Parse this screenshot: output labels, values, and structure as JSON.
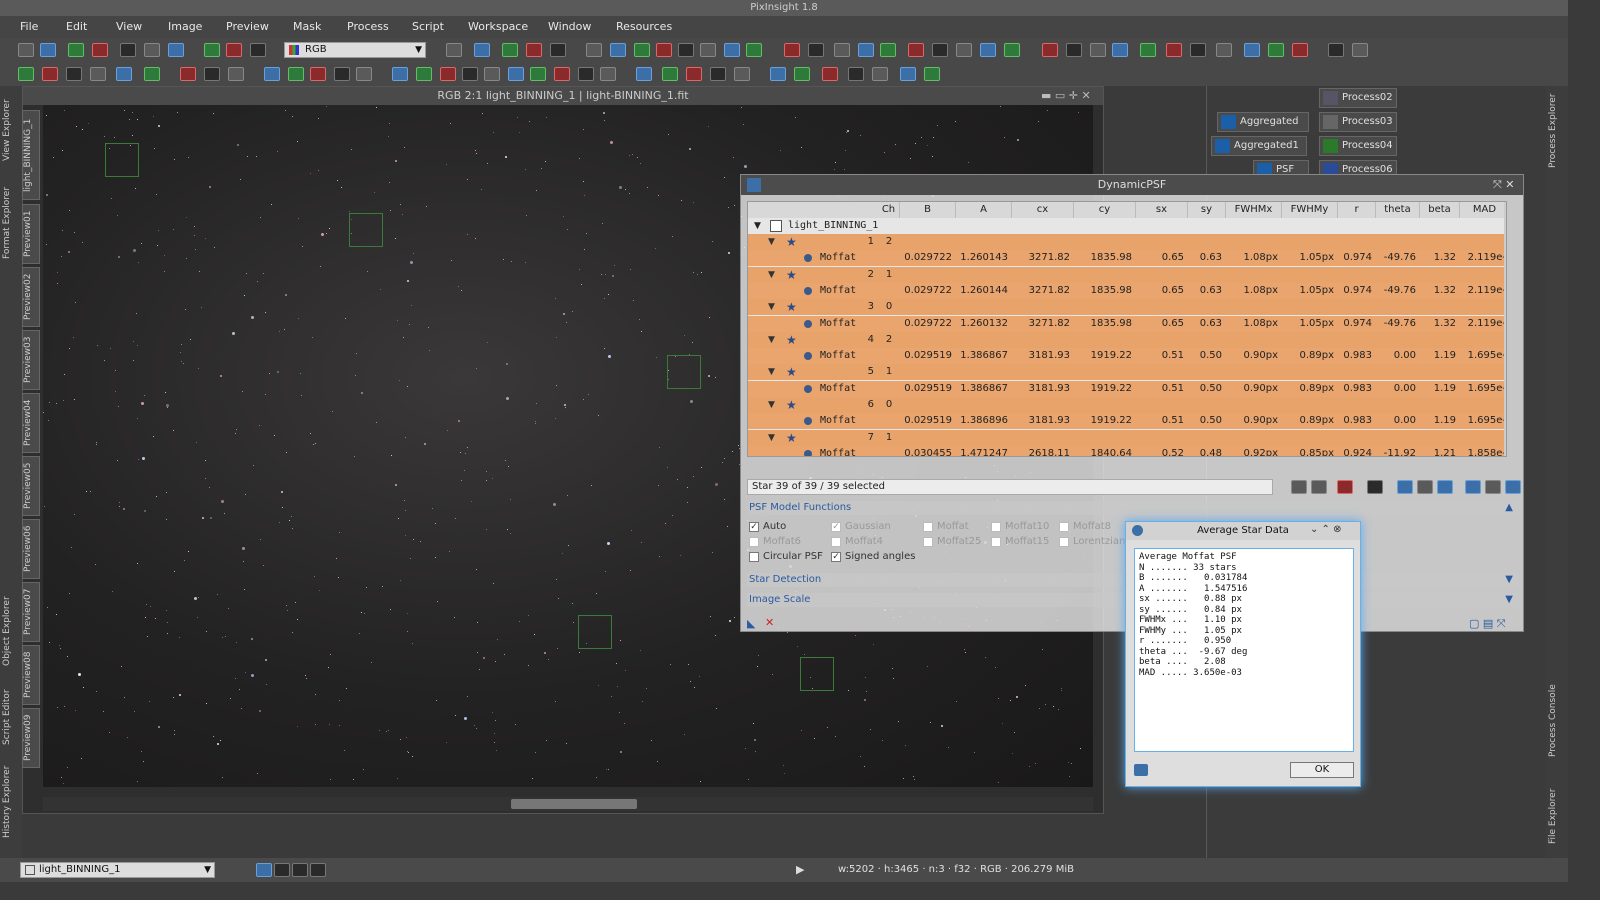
{
  "app": {
    "title": "PixInsight 1.8"
  },
  "menu": [
    "File",
    "Edit",
    "View",
    "Image",
    "Preview",
    "Mask",
    "Process",
    "Script",
    "Workspace",
    "Window",
    "Resources"
  ],
  "toolbar": {
    "color_mode": "RGB"
  },
  "image_window": {
    "title": "RGB 2:1 light_BINNING_1 | light-BINNING_1.fit",
    "view_tab": "light_BINNING_1",
    "preview_tabs": [
      "Preview01",
      "Preview02",
      "Preview03",
      "Preview04",
      "Preview05",
      "Preview06",
      "Preview07",
      "Preview08",
      "Preview09"
    ]
  },
  "left_panels": [
    "View Explorer",
    "Format Explorer",
    "Object Explorer",
    "Script Editor",
    "History Explorer"
  ],
  "right_panels": [
    "Process Explorer",
    "Process Console",
    "File Explorer"
  ],
  "process_icons": [
    "Process02",
    "Aggregated",
    "Process03",
    "Aggregated1",
    "Process04",
    "PSF",
    "Process06"
  ],
  "dynamicpsf": {
    "title": "DynamicPSF",
    "columns": [
      "Ch",
      "B",
      "A",
      "cx",
      "cy",
      "sx",
      "sy",
      "FWHMx",
      "FWHMy",
      "r",
      "theta",
      "beta",
      "MAD"
    ],
    "root": "light_BINNING_1",
    "stars": [
      {
        "n": "1",
        "ch": "2",
        "fit": {
          "name": "Moffat",
          "B": "0.029722",
          "A": "1.260143",
          "cx": "3271.82",
          "cy": "1835.98",
          "sx": "0.65",
          "sy": "0.63",
          "FWHMx": "1.08px",
          "FWHMy": "1.05px",
          "r": "0.974",
          "theta": "-49.76",
          "beta": "1.32",
          "MAD": "2.119e-"
        }
      },
      {
        "n": "2",
        "ch": "1",
        "fit": {
          "name": "Moffat",
          "B": "0.029722",
          "A": "1.260144",
          "cx": "3271.82",
          "cy": "1835.98",
          "sx": "0.65",
          "sy": "0.63",
          "FWHMx": "1.08px",
          "FWHMy": "1.05px",
          "r": "0.974",
          "theta": "-49.76",
          "beta": "1.32",
          "MAD": "2.119e-"
        }
      },
      {
        "n": "3",
        "ch": "0",
        "fit": {
          "name": "Moffat",
          "B": "0.029722",
          "A": "1.260132",
          "cx": "3271.82",
          "cy": "1835.98",
          "sx": "0.65",
          "sy": "0.63",
          "FWHMx": "1.08px",
          "FWHMy": "1.05px",
          "r": "0.974",
          "theta": "-49.76",
          "beta": "1.32",
          "MAD": "2.119e-"
        }
      },
      {
        "n": "4",
        "ch": "2",
        "fit": {
          "name": "Moffat",
          "B": "0.029519",
          "A": "1.386867",
          "cx": "3181.93",
          "cy": "1919.22",
          "sx": "0.51",
          "sy": "0.50",
          "FWHMx": "0.90px",
          "FWHMy": "0.89px",
          "r": "0.983",
          "theta": "0.00",
          "beta": "1.19",
          "MAD": "1.695e-"
        }
      },
      {
        "n": "5",
        "ch": "1",
        "fit": {
          "name": "Moffat",
          "B": "0.029519",
          "A": "1.386867",
          "cx": "3181.93",
          "cy": "1919.22",
          "sx": "0.51",
          "sy": "0.50",
          "FWHMx": "0.90px",
          "FWHMy": "0.89px",
          "r": "0.983",
          "theta": "0.00",
          "beta": "1.19",
          "MAD": "1.695e-"
        }
      },
      {
        "n": "6",
        "ch": "0",
        "fit": {
          "name": "Moffat",
          "B": "0.029519",
          "A": "1.386896",
          "cx": "3181.93",
          "cy": "1919.22",
          "sx": "0.51",
          "sy": "0.50",
          "FWHMx": "0.90px",
          "FWHMy": "0.89px",
          "r": "0.983",
          "theta": "0.00",
          "beta": "1.19",
          "MAD": "1.695e-"
        }
      },
      {
        "n": "7",
        "ch": "1",
        "fit": {
          "name": "Moffat",
          "B": "0.030455",
          "A": "1.471247",
          "cx": "2618.11",
          "cy": "1840.64",
          "sx": "0.52",
          "sy": "0.48",
          "FWHMx": "0.92px",
          "FWHMy": "0.85px",
          "r": "0.924",
          "theta": "-11.92",
          "beta": "1.21",
          "MAD": "1.858e-"
        }
      }
    ],
    "selection": "Star    39 of    39 / 39 selected",
    "sections": {
      "psf": "PSF Model Functions",
      "detect": "Star Detection",
      "scale": "Image Scale"
    },
    "functions": [
      {
        "label": "Auto",
        "checked": true,
        "enabled": true
      },
      {
        "label": "Gaussian",
        "checked": true,
        "enabled": false
      },
      {
        "label": "Moffat",
        "checked": false,
        "enabled": false
      },
      {
        "label": "Moffat10",
        "checked": false,
        "enabled": false
      },
      {
        "label": "Moffat8",
        "checked": false,
        "enabled": false
      },
      {
        "label": "Moffat6",
        "checked": false,
        "enabled": false
      },
      {
        "label": "Moffat4",
        "checked": false,
        "enabled": false
      },
      {
        "label": "Moffat25",
        "checked": false,
        "enabled": false
      },
      {
        "label": "Moffat15",
        "checked": false,
        "enabled": false
      },
      {
        "label": "Lorentzian",
        "checked": false,
        "enabled": false
      },
      {
        "label": "Circular PSF",
        "checked": false,
        "enabled": true
      },
      {
        "label": "Signed angles",
        "checked": true,
        "enabled": true
      }
    ]
  },
  "average_star": {
    "title": "Average Star Data",
    "lines": [
      "Average Moffat PSF",
      "N ....... 33 stars",
      "B .......   0.031784",
      "A .......   1.547516",
      "sx ......   0.88 px",
      "sy ......   0.84 px",
      "FWHMx ...   1.10 px",
      "FWHMy ...   1.05 px",
      "r .......   0.950",
      "theta ...  -9.67 deg",
      "beta ....   2.08",
      "MAD ..... 3.650e-03"
    ],
    "ok": "OK"
  },
  "status": {
    "view": "light_BINNING_1",
    "info": "w:5202  ·  h:3465  ·  n:3  ·  f32  ·  RGB  ·  206.279 MiB"
  }
}
